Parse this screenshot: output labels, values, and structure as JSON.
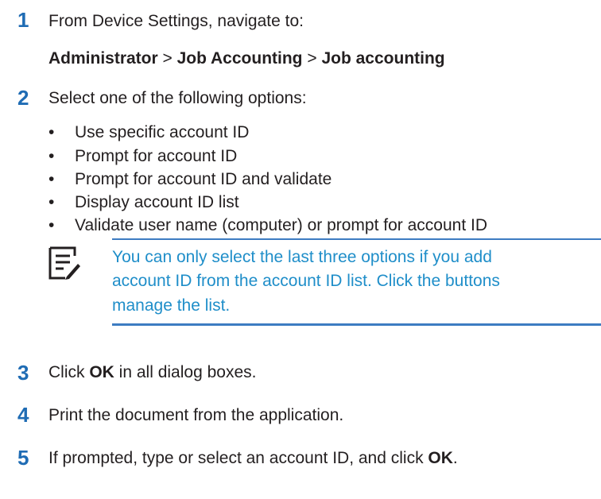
{
  "steps": [
    {
      "number": "1",
      "text": "From Device Settings, navigate to:",
      "path": {
        "part1": "Administrator",
        "sep1": " > ",
        "part2": "Job Accounting",
        "sep2": " > ",
        "part3": "Job accounting"
      }
    },
    {
      "number": "2",
      "text": "Select one of the following options:",
      "bullet_symbol": "•",
      "options": [
        "Use specific account ID",
        "Prompt for account ID",
        "Prompt for account ID and validate",
        "Display account ID list",
        "Validate user name (computer) or prompt for account ID"
      ]
    },
    {
      "number": "3",
      "text_before": "Click ",
      "bold": "OK",
      "text_after": " in all dialog boxes."
    },
    {
      "number": "4",
      "text": "Print the document from the application."
    },
    {
      "number": "5",
      "text_before": "If prompted, type or select an account ID, and click ",
      "bold": "OK",
      "text_after": "."
    }
  ],
  "note": {
    "icon": "note-pencil-icon",
    "lines": [
      "You can only select the last three options if you add",
      "account ID from the account ID list. Click the buttons",
      "manage the list."
    ]
  },
  "colors": {
    "step_number": "#1f6cb4",
    "note_text": "#1f8ec9",
    "note_rule": "#3d7cc2",
    "body_text": "#231f20"
  }
}
